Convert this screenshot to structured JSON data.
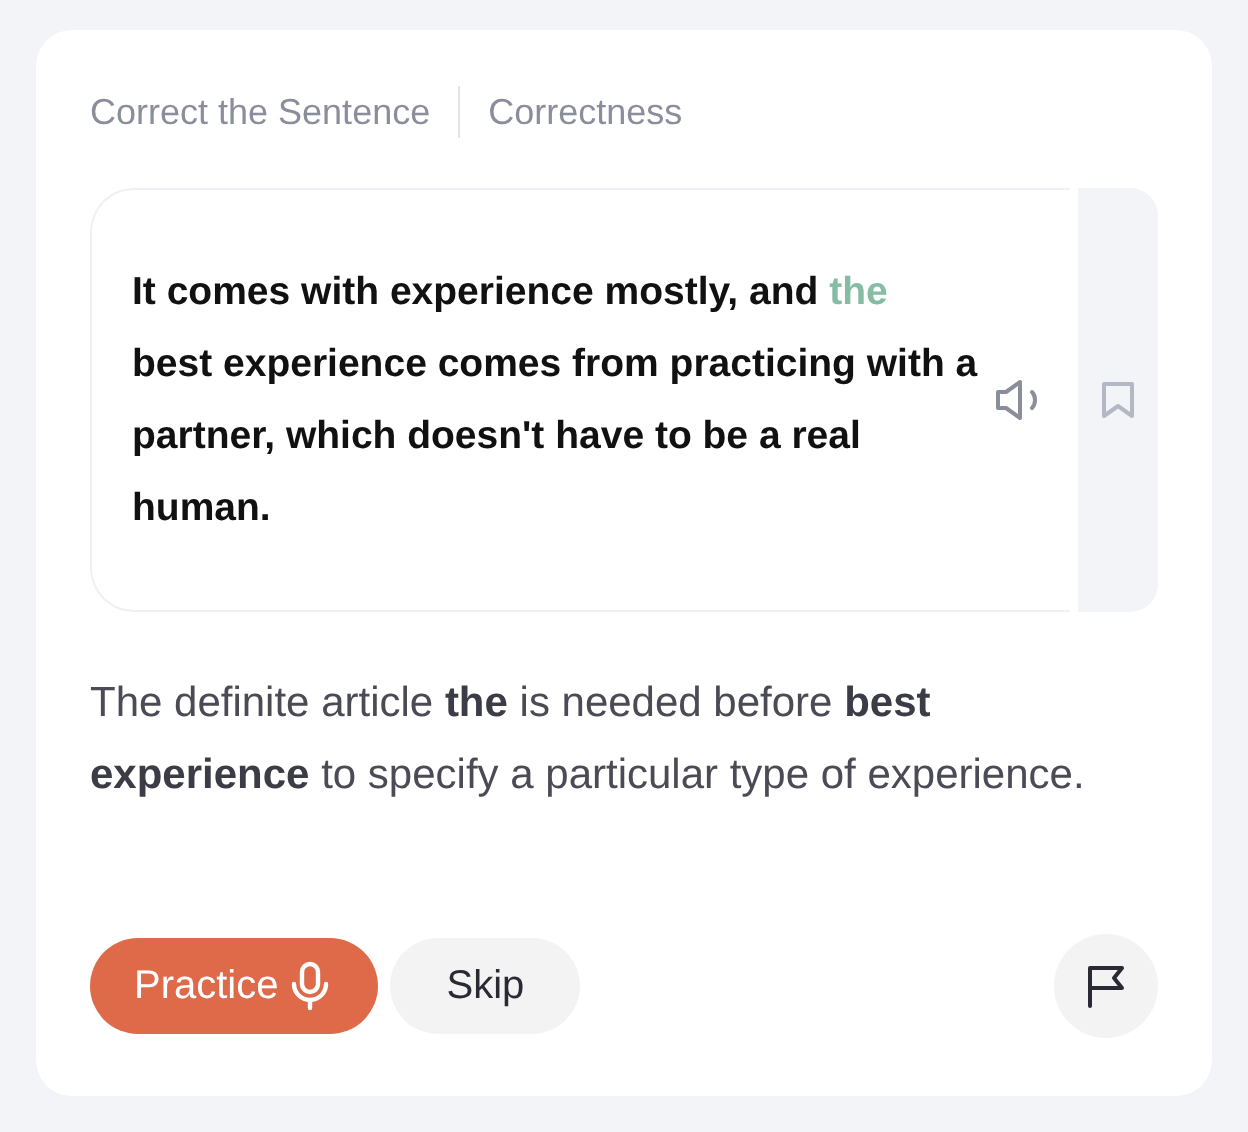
{
  "header": {
    "category": "Correct the Sentence",
    "tag": "Correctness"
  },
  "sentence": [
    {
      "kind": "plain",
      "text": "It comes with experience mostly, and "
    },
    {
      "kind": "highlight",
      "text": "the"
    },
    {
      "kind": "plain",
      "text": " best experience comes from practicing with a partner, which doesn't have to be a real human."
    }
  ],
  "explanation": "The definite article **the** is needed before **best experience** to specify a particular type of experience.",
  "buttons": [
    {
      "kind": "primary",
      "label": "Practice"
    },
    {
      "kind": "secondary",
      "label": "Skip"
    }
  ]
}
